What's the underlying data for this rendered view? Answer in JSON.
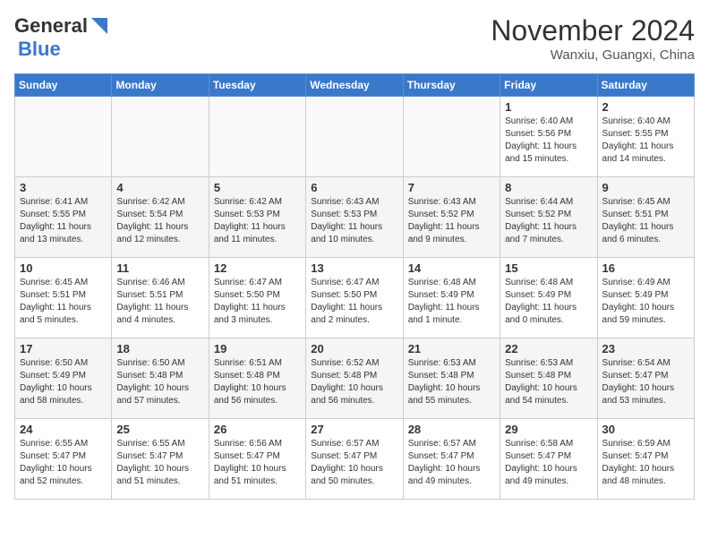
{
  "header": {
    "logo_line1": "General",
    "logo_line2": "Blue",
    "month_title": "November 2024",
    "location": "Wanxiu, Guangxi, China"
  },
  "days_of_week": [
    "Sunday",
    "Monday",
    "Tuesday",
    "Wednesday",
    "Thursday",
    "Friday",
    "Saturday"
  ],
  "weeks": [
    [
      {
        "day": "",
        "content": ""
      },
      {
        "day": "",
        "content": ""
      },
      {
        "day": "",
        "content": ""
      },
      {
        "day": "",
        "content": ""
      },
      {
        "day": "",
        "content": ""
      },
      {
        "day": "1",
        "content": "Sunrise: 6:40 AM\nSunset: 5:56 PM\nDaylight: 11 hours and 15 minutes."
      },
      {
        "day": "2",
        "content": "Sunrise: 6:40 AM\nSunset: 5:55 PM\nDaylight: 11 hours and 14 minutes."
      }
    ],
    [
      {
        "day": "3",
        "content": "Sunrise: 6:41 AM\nSunset: 5:55 PM\nDaylight: 11 hours and 13 minutes."
      },
      {
        "day": "4",
        "content": "Sunrise: 6:42 AM\nSunset: 5:54 PM\nDaylight: 11 hours and 12 minutes."
      },
      {
        "day": "5",
        "content": "Sunrise: 6:42 AM\nSunset: 5:53 PM\nDaylight: 11 hours and 11 minutes."
      },
      {
        "day": "6",
        "content": "Sunrise: 6:43 AM\nSunset: 5:53 PM\nDaylight: 11 hours and 10 minutes."
      },
      {
        "day": "7",
        "content": "Sunrise: 6:43 AM\nSunset: 5:52 PM\nDaylight: 11 hours and 9 minutes."
      },
      {
        "day": "8",
        "content": "Sunrise: 6:44 AM\nSunset: 5:52 PM\nDaylight: 11 hours and 7 minutes."
      },
      {
        "day": "9",
        "content": "Sunrise: 6:45 AM\nSunset: 5:51 PM\nDaylight: 11 hours and 6 minutes."
      }
    ],
    [
      {
        "day": "10",
        "content": "Sunrise: 6:45 AM\nSunset: 5:51 PM\nDaylight: 11 hours and 5 minutes."
      },
      {
        "day": "11",
        "content": "Sunrise: 6:46 AM\nSunset: 5:51 PM\nDaylight: 11 hours and 4 minutes."
      },
      {
        "day": "12",
        "content": "Sunrise: 6:47 AM\nSunset: 5:50 PM\nDaylight: 11 hours and 3 minutes."
      },
      {
        "day": "13",
        "content": "Sunrise: 6:47 AM\nSunset: 5:50 PM\nDaylight: 11 hours and 2 minutes."
      },
      {
        "day": "14",
        "content": "Sunrise: 6:48 AM\nSunset: 5:49 PM\nDaylight: 11 hours and 1 minute."
      },
      {
        "day": "15",
        "content": "Sunrise: 6:48 AM\nSunset: 5:49 PM\nDaylight: 11 hours and 0 minutes."
      },
      {
        "day": "16",
        "content": "Sunrise: 6:49 AM\nSunset: 5:49 PM\nDaylight: 10 hours and 59 minutes."
      }
    ],
    [
      {
        "day": "17",
        "content": "Sunrise: 6:50 AM\nSunset: 5:49 PM\nDaylight: 10 hours and 58 minutes."
      },
      {
        "day": "18",
        "content": "Sunrise: 6:50 AM\nSunset: 5:48 PM\nDaylight: 10 hours and 57 minutes."
      },
      {
        "day": "19",
        "content": "Sunrise: 6:51 AM\nSunset: 5:48 PM\nDaylight: 10 hours and 56 minutes."
      },
      {
        "day": "20",
        "content": "Sunrise: 6:52 AM\nSunset: 5:48 PM\nDaylight: 10 hours and 56 minutes."
      },
      {
        "day": "21",
        "content": "Sunrise: 6:53 AM\nSunset: 5:48 PM\nDaylight: 10 hours and 55 minutes."
      },
      {
        "day": "22",
        "content": "Sunrise: 6:53 AM\nSunset: 5:48 PM\nDaylight: 10 hours and 54 minutes."
      },
      {
        "day": "23",
        "content": "Sunrise: 6:54 AM\nSunset: 5:47 PM\nDaylight: 10 hours and 53 minutes."
      }
    ],
    [
      {
        "day": "24",
        "content": "Sunrise: 6:55 AM\nSunset: 5:47 PM\nDaylight: 10 hours and 52 minutes."
      },
      {
        "day": "25",
        "content": "Sunrise: 6:55 AM\nSunset: 5:47 PM\nDaylight: 10 hours and 51 minutes."
      },
      {
        "day": "26",
        "content": "Sunrise: 6:56 AM\nSunset: 5:47 PM\nDaylight: 10 hours and 51 minutes."
      },
      {
        "day": "27",
        "content": "Sunrise: 6:57 AM\nSunset: 5:47 PM\nDaylight: 10 hours and 50 minutes."
      },
      {
        "day": "28",
        "content": "Sunrise: 6:57 AM\nSunset: 5:47 PM\nDaylight: 10 hours and 49 minutes."
      },
      {
        "day": "29",
        "content": "Sunrise: 6:58 AM\nSunset: 5:47 PM\nDaylight: 10 hours and 49 minutes."
      },
      {
        "day": "30",
        "content": "Sunrise: 6:59 AM\nSunset: 5:47 PM\nDaylight: 10 hours and 48 minutes."
      }
    ]
  ]
}
